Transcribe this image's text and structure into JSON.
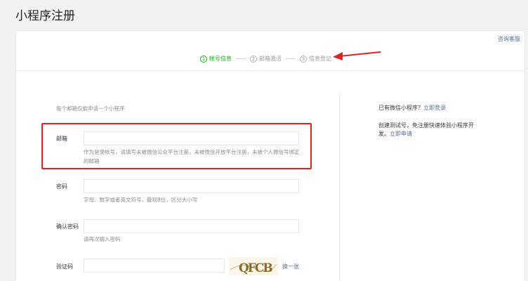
{
  "page": {
    "title": "小程序注册"
  },
  "header": {
    "service_link": "咨询客服"
  },
  "steps": [
    {
      "num": "1",
      "label": "帐号信息"
    },
    {
      "num": "2",
      "label": "邮箱激活"
    },
    {
      "num": "3",
      "label": "信息登记"
    }
  ],
  "form": {
    "hint": "每个邮箱仅能申请一个小程序",
    "email": {
      "label": "邮箱",
      "value": "",
      "help": "作为登录帐号，请填写未被微信公众平台注册，未被微信开放平台注册，未被个人微信号绑定的邮箱"
    },
    "password": {
      "label": "密码",
      "value": "",
      "help": "字母、数字或者英文符号，最短8位，区分大小写"
    },
    "confirm": {
      "label": "确认密码",
      "value": "",
      "help": "请再次输入密码"
    },
    "captcha": {
      "label": "验证码",
      "value": "",
      "refresh": "换一张",
      "image_text": "QFCB"
    }
  },
  "sidebar": {
    "has_account": "已有微信小程序？",
    "login_link": "立即登录",
    "test_text": "创建测试号，免注册快速体验小程序开发。",
    "apply_link": "立即申请"
  },
  "colors": {
    "accent": "#1aad19",
    "link": "#576b95",
    "annotation": "#e02222"
  }
}
